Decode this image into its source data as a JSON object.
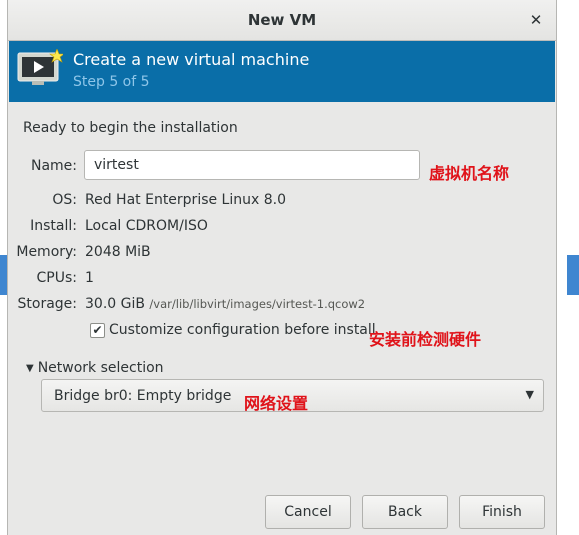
{
  "window": {
    "title": "New VM",
    "close_glyph": "✕"
  },
  "header": {
    "title": "Create a new virtual machine",
    "step": "Step 5 of 5",
    "icon": "monitor-play-icon"
  },
  "summary": {
    "heading": "Ready to begin the installation",
    "name_label": "Name:",
    "name_value": "virtest",
    "os_label": "OS:",
    "os_value": "Red Hat Enterprise Linux 8.0",
    "install_label": "Install:",
    "install_value": "Local CDROM/ISO",
    "memory_label": "Memory:",
    "memory_value": "2048 MiB",
    "cpus_label": "CPUs:",
    "cpus_value": "1",
    "storage_label": "Storage:",
    "storage_size": "30.0 GiB",
    "storage_path": "/var/lib/libvirt/images/virtest-1.qcow2"
  },
  "customize": {
    "checked": true,
    "check_glyph": "✔",
    "label": "Customize configuration before install"
  },
  "network": {
    "expander_label": "Network selection",
    "expander_glyph": "▼",
    "selected": "Bridge br0: Empty bridge",
    "arrow_glyph": "▼"
  },
  "annotations": {
    "name_note": "虚拟机名称",
    "hardware_note": "安装前检测硬件",
    "network_note": "网络设置"
  },
  "buttons": {
    "cancel": "Cancel",
    "back": "Back",
    "finish": "Finish"
  },
  "colors": {
    "header_bg": "#0a6ea8",
    "annotation": "#e0131a",
    "step_text": "#8fc6e9"
  }
}
